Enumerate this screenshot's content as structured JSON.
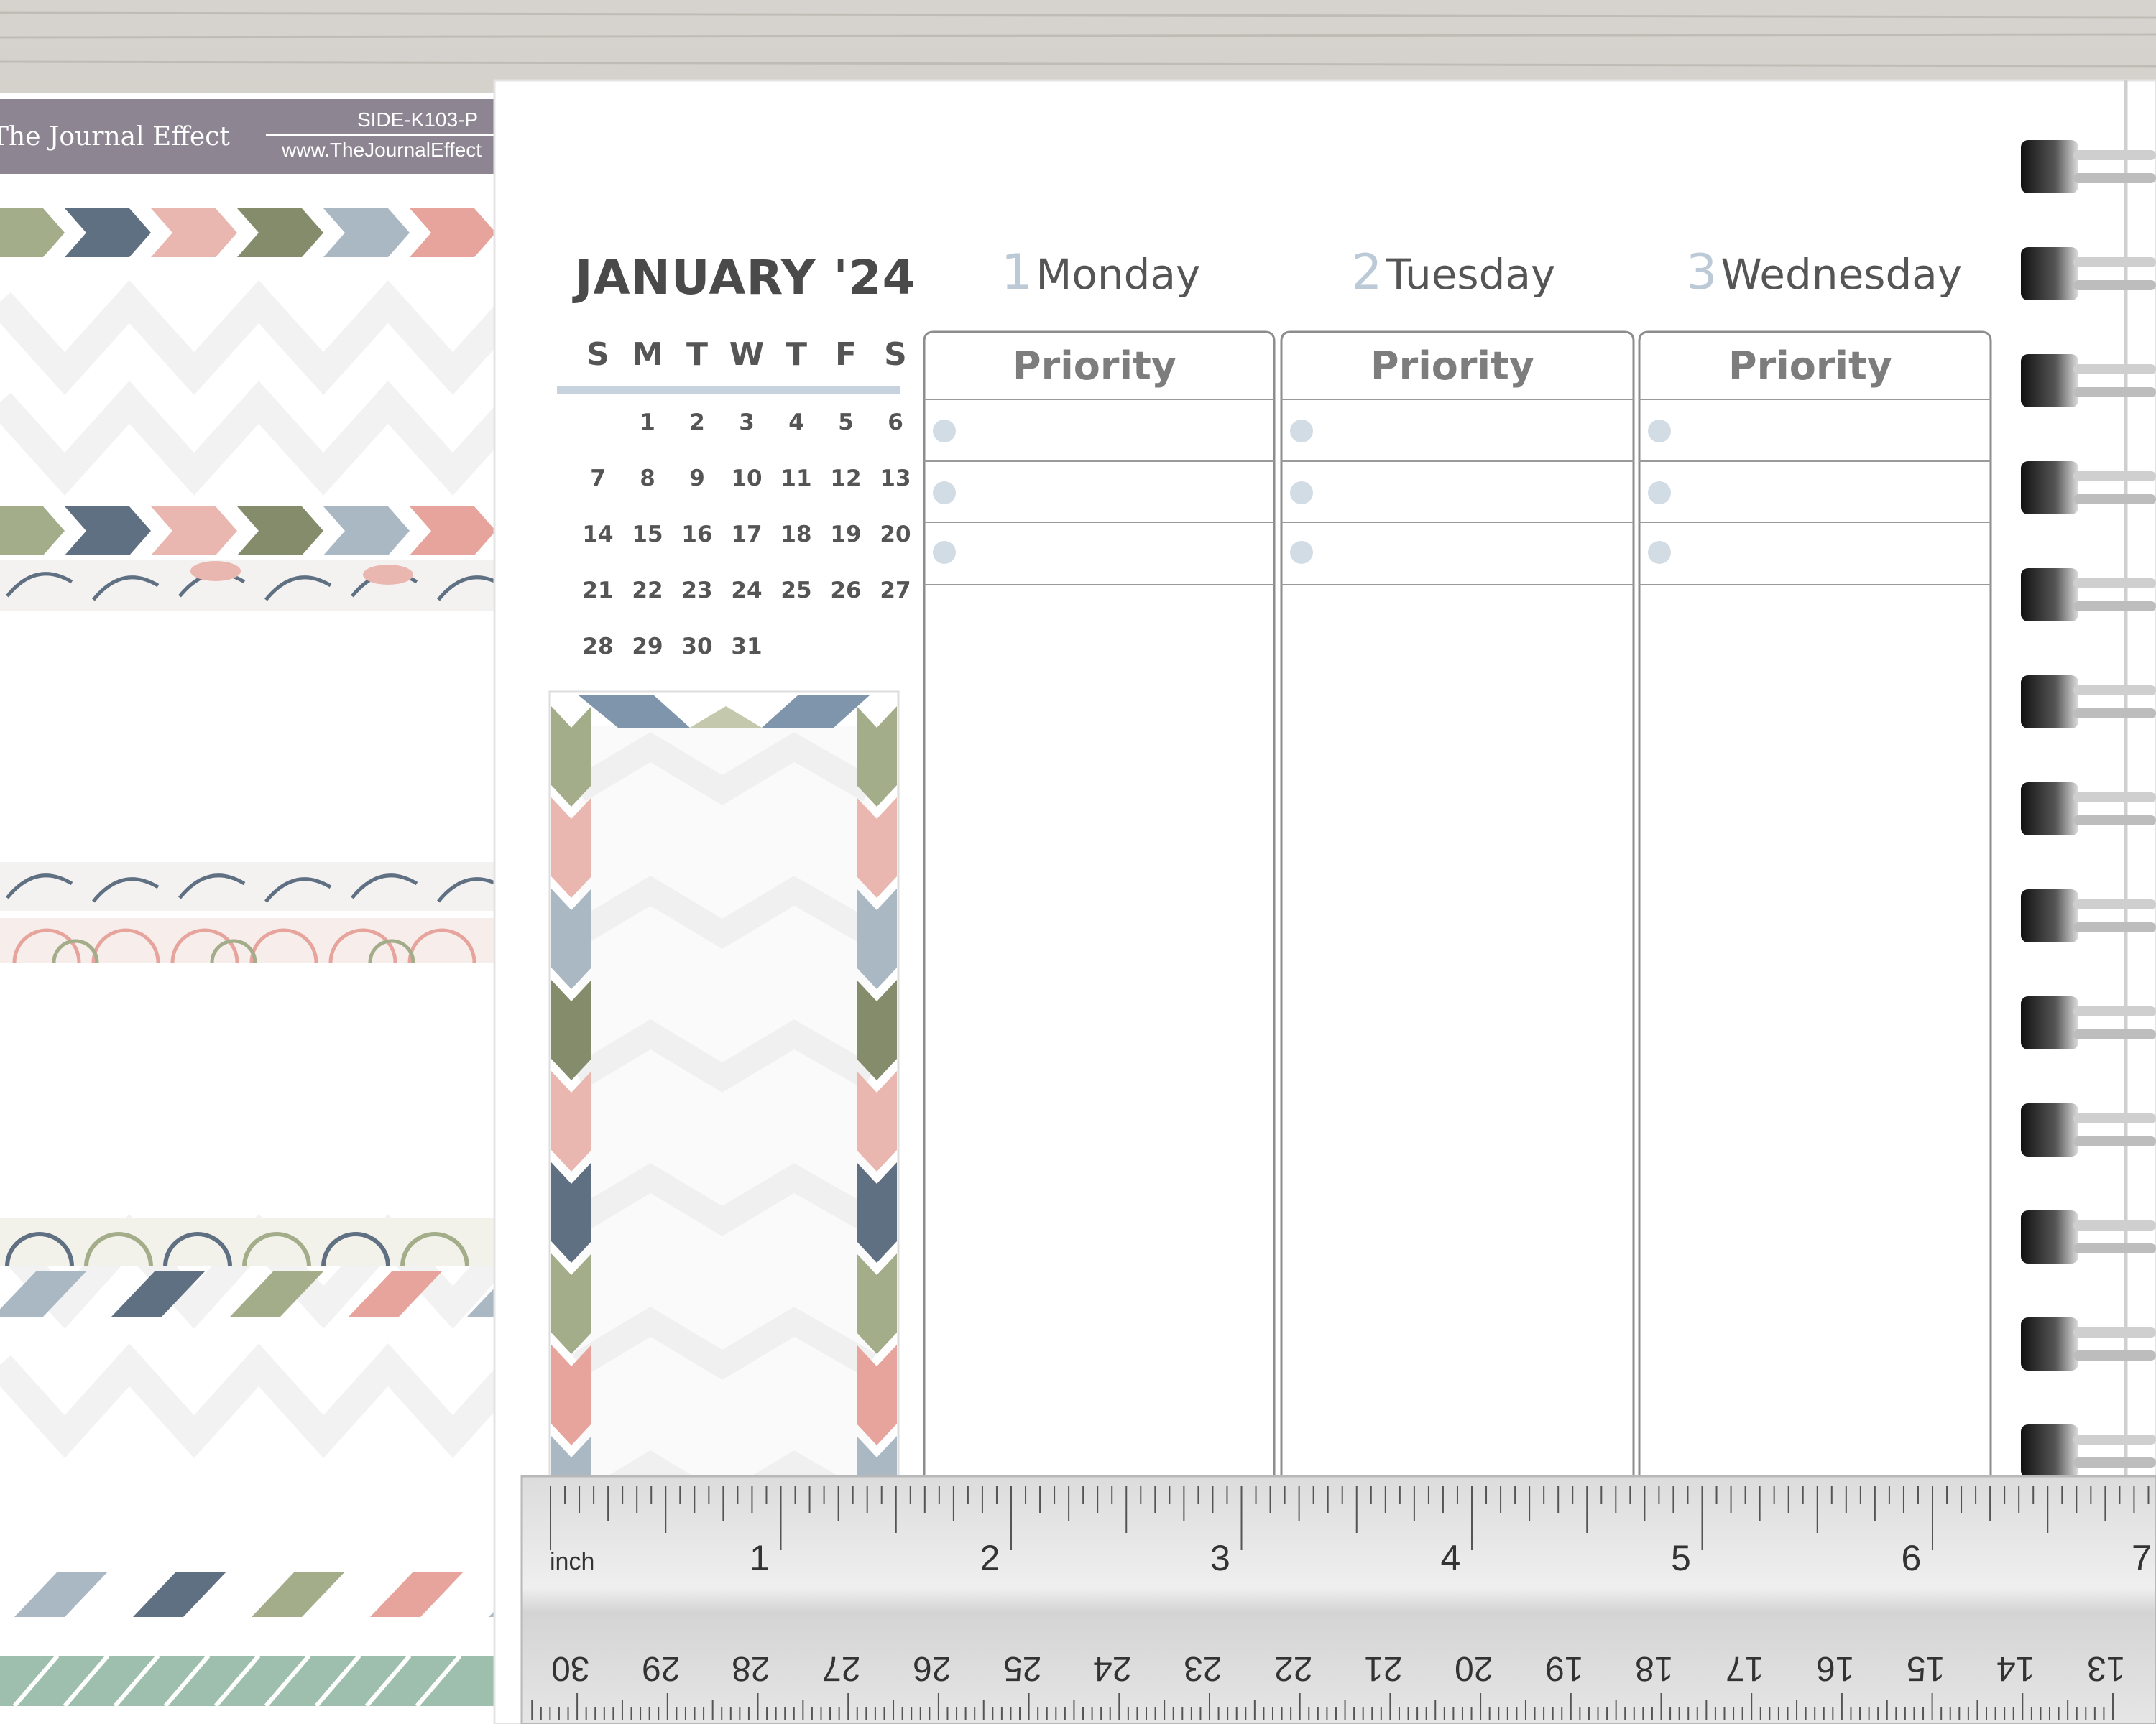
{
  "sticker_sheet": {
    "brand": "The Journal Effect",
    "sku": "SIDE-K103-P",
    "url": "www.TheJournalEffect"
  },
  "planner": {
    "month_title": "JANUARY '24",
    "weekday_headers": [
      "S",
      "M",
      "T",
      "W",
      "T",
      "F",
      "S"
    ],
    "calendar_rows": [
      [
        "",
        "1",
        "2",
        "3",
        "4",
        "5",
        "6"
      ],
      [
        "7",
        "8",
        "9",
        "10",
        "11",
        "12",
        "13"
      ],
      [
        "14",
        "15",
        "16",
        "17",
        "18",
        "19",
        "20"
      ],
      [
        "21",
        "22",
        "23",
        "24",
        "25",
        "26",
        "27"
      ],
      [
        "28",
        "29",
        "30",
        "31",
        "",
        "",
        ""
      ]
    ],
    "days": [
      {
        "number": "1",
        "name": "Monday",
        "priority_label": "Priority"
      },
      {
        "number": "2",
        "name": "Tuesday",
        "priority_label": "Priority"
      },
      {
        "number": "3",
        "name": "Wednesday",
        "priority_label": "Priority"
      }
    ]
  },
  "ruler": {
    "unit_label": "inch",
    "inch_marks": [
      "1",
      "2",
      "3",
      "4",
      "5",
      "6",
      "7"
    ],
    "cm_marks": [
      "30",
      "29",
      "28",
      "27",
      "26",
      "25",
      "24",
      "23",
      "22",
      "21",
      "20",
      "19",
      "18",
      "17",
      "16",
      "15",
      "14",
      "13"
    ]
  },
  "colors": {
    "sage": "#a3ad8a",
    "slate": "#5f7083",
    "blush": "#e9b7b0",
    "olive": "#858c6b",
    "powder": "#aab8c4",
    "salmon": "#e6a49c",
    "mint": "#9fbfae",
    "sheet_header": "#8d8692",
    "wood": "#c9c5bf",
    "accent_blue": "#bcc9d6"
  }
}
